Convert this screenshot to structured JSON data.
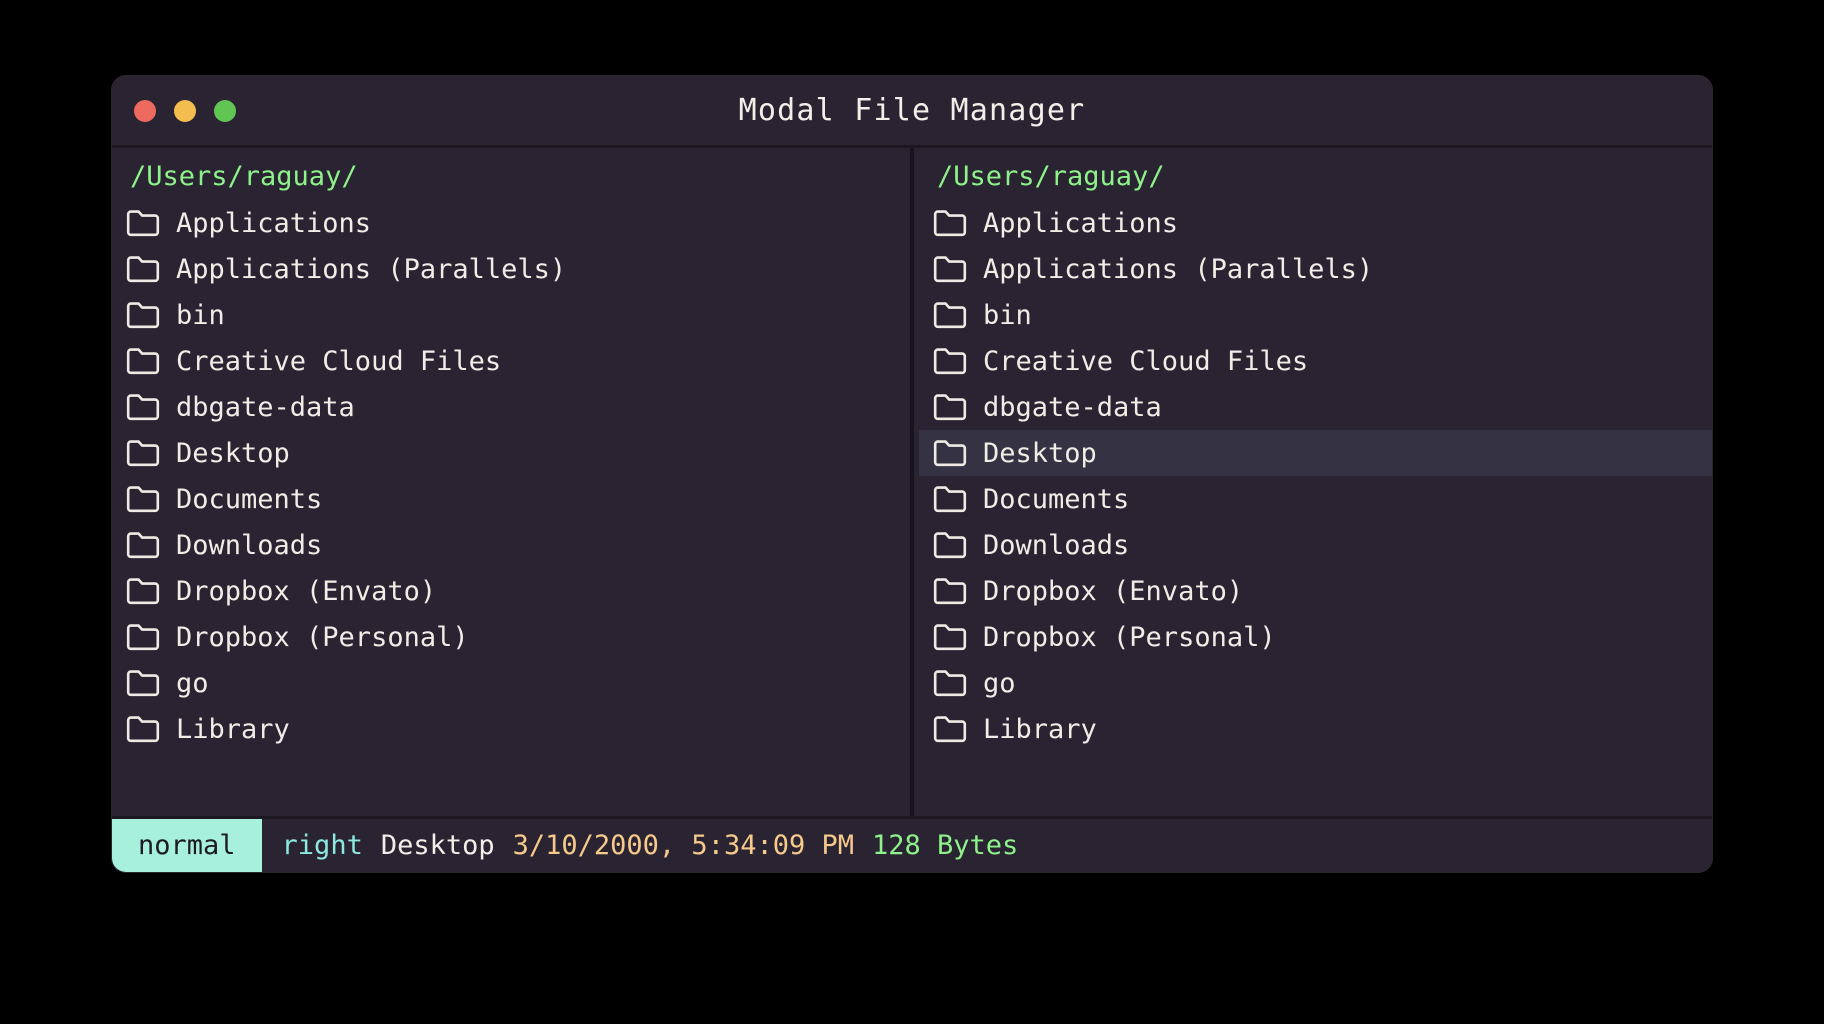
{
  "window": {
    "title": "Modal File Manager",
    "traffic_lights": [
      {
        "name": "close",
        "color": "#ec6a5e"
      },
      {
        "name": "minimize",
        "color": "#f4bd4f"
      },
      {
        "name": "maximize",
        "color": "#61c554"
      }
    ]
  },
  "panels": {
    "left": {
      "path": "/Users/raguay/",
      "selected_index": null,
      "items": [
        {
          "icon": "folder-icon",
          "label": "Applications"
        },
        {
          "icon": "folder-icon",
          "label": "Applications (Parallels)"
        },
        {
          "icon": "folder-icon",
          "label": "bin"
        },
        {
          "icon": "folder-icon",
          "label": "Creative Cloud Files"
        },
        {
          "icon": "folder-icon",
          "label": "dbgate-data"
        },
        {
          "icon": "folder-icon",
          "label": "Desktop"
        },
        {
          "icon": "folder-icon",
          "label": "Documents"
        },
        {
          "icon": "folder-icon",
          "label": "Downloads"
        },
        {
          "icon": "folder-icon",
          "label": "Dropbox (Envato)"
        },
        {
          "icon": "folder-icon",
          "label": "Dropbox (Personal)"
        },
        {
          "icon": "folder-icon",
          "label": "go"
        },
        {
          "icon": "folder-icon",
          "label": "Library"
        }
      ]
    },
    "right": {
      "path": "/Users/raguay/",
      "selected_index": 5,
      "items": [
        {
          "icon": "folder-icon",
          "label": "Applications"
        },
        {
          "icon": "folder-icon",
          "label": "Applications (Parallels)"
        },
        {
          "icon": "folder-icon",
          "label": "bin"
        },
        {
          "icon": "folder-icon",
          "label": "Creative Cloud Files"
        },
        {
          "icon": "folder-icon",
          "label": "dbgate-data"
        },
        {
          "icon": "folder-icon",
          "label": "Desktop"
        },
        {
          "icon": "folder-icon",
          "label": "Documents"
        },
        {
          "icon": "folder-icon",
          "label": "Downloads"
        },
        {
          "icon": "folder-icon",
          "label": "Dropbox (Envato)"
        },
        {
          "icon": "folder-icon",
          "label": "Dropbox (Personal)"
        },
        {
          "icon": "folder-icon",
          "label": "go"
        },
        {
          "icon": "folder-icon",
          "label": "Library"
        }
      ]
    }
  },
  "statusbar": {
    "mode": "normal",
    "active_pane": "right",
    "selected_name": "Desktop",
    "modified": "3/10/2000, 5:34:09 PM",
    "size": "128 Bytes"
  },
  "colors": {
    "window_background": "#2a2432",
    "desktop_background": "#000000",
    "path_green": "#8ef28a",
    "text_primary": "#f0ece6",
    "row_selected": "#353343",
    "mode_badge_bg": "#a6f0dc",
    "mode_badge_text": "#1d1a24",
    "status_pane": "#8ce8e0",
    "status_date": "#f7c98b",
    "status_size": "#8ef28a",
    "separator": "#1c1822"
  }
}
